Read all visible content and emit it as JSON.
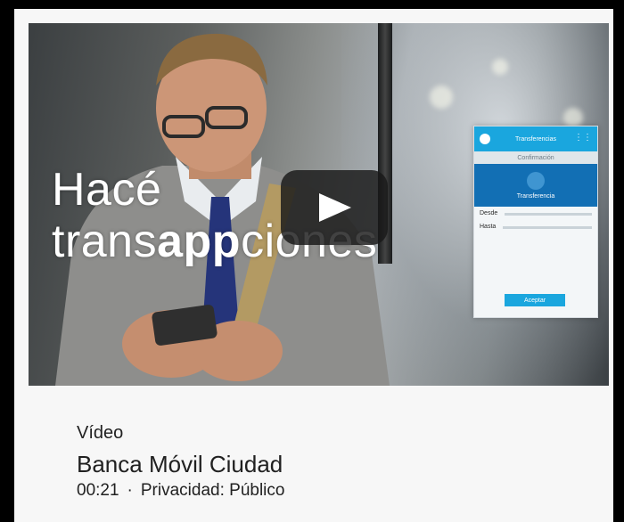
{
  "video": {
    "headline_line1": "Hacé",
    "headline_line2_pre": "trans",
    "headline_line2_bold": "app",
    "headline_line2_post": "ciones",
    "phone_mockup": {
      "title": "Transferencias",
      "subtitle": "Confirmación",
      "section": "Transferencia",
      "field_from": "Desde",
      "field_to": "Hasta",
      "button": "Aceptar"
    }
  },
  "details": {
    "type_label": "Vídeo",
    "title": "Banca Móvil Ciudad",
    "duration": "00:21",
    "separator": "·",
    "privacy": "Privacidad: Público"
  },
  "colors": {
    "card_bg": "#f7f7f7",
    "page_bg": "#000000",
    "text": "#212121",
    "play_button": "#181818",
    "phone_accent": "#1aa6de"
  },
  "icons": {
    "play": "play-icon"
  }
}
